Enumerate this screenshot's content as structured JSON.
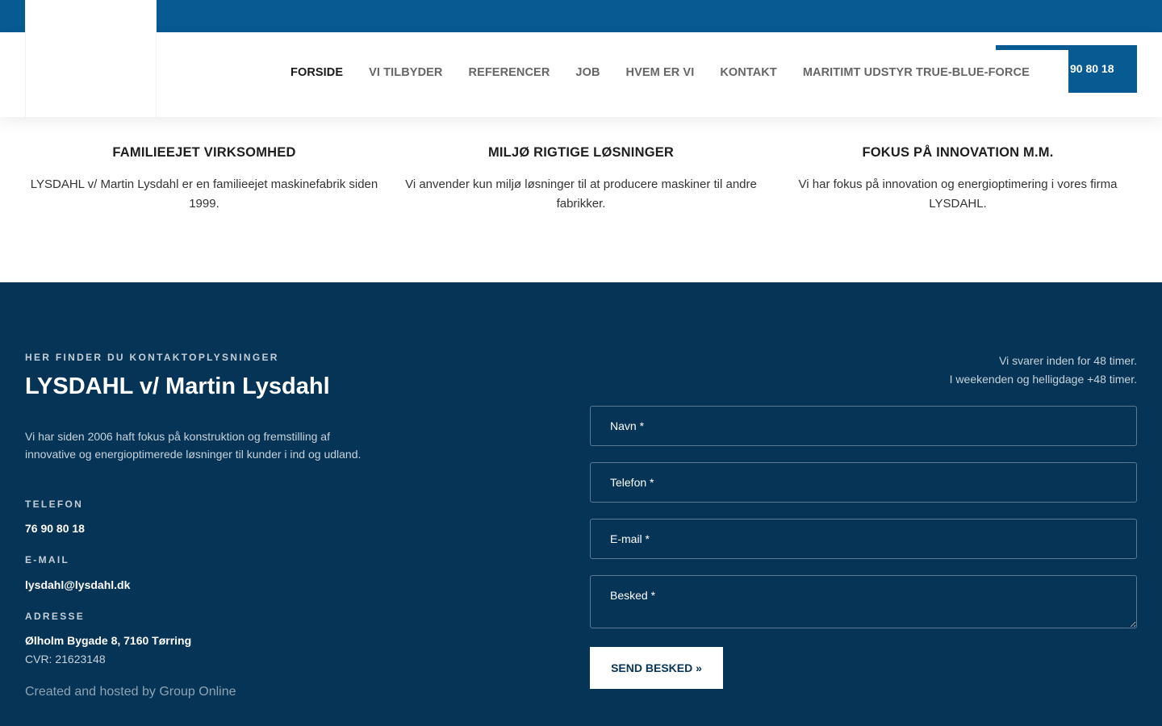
{
  "nav": {
    "items": [
      {
        "label": "FORSIDE"
      },
      {
        "label": "VI TILBYDER"
      },
      {
        "label": "REFERENCER"
      },
      {
        "label": "JOB"
      },
      {
        "label": "HVEM ER VI"
      },
      {
        "label": "KONTAKT"
      },
      {
        "label": "MARITIMT UDSTYR TRUE-BLUE-FORCE"
      }
    ],
    "phone": "90 80 18"
  },
  "features": [
    {
      "title": "FAMILIEEJET VIRKSOMHED",
      "text": "LYSDAHL v/ Martin Lysdahl er en familieejet maskinefabrik siden 1999."
    },
    {
      "title": "MILJØ RIGTIGE LØSNINGER",
      "text": "Vi anvender kun miljø løsninger til at producere maskiner til andre fabrikker."
    },
    {
      "title": "FOKUS PÅ INNOVATION M.M.",
      "text": "Vi har fokus på innovation og energioptimering i vores firma LYSDAHL."
    }
  ],
  "footer": {
    "kicker": "HER FINDER DU KONTAKTOPLYSNINGER",
    "title": "LYSDAHL v/ Martin Lysdahl",
    "description": "Vi har siden 2006 haft fokus på konstruktion og fremstilling af innovative og energioptimerede løsninger til kunder i ind og udland.",
    "phone_label": "TELEFON",
    "phone": "76 90 80 18",
    "email_label": "E-MAIL",
    "email": "lysdahl@lysdahl.dk",
    "address_label": "ADRESSE",
    "address": "Ølholm Bygade 8, 7160 Tørring",
    "cvr": "CVR: 21623148",
    "credit": "Created and hosted by Group Online",
    "notice_line1": "Vi svarer inden for 48 timer.",
    "notice_line2": "I weekenden og helligdage +48 timer."
  },
  "form": {
    "name_placeholder": "Navn *",
    "phone_placeholder": "Telefon *",
    "email_placeholder": "E-mail *",
    "message_placeholder": "Besked *",
    "submit_label": "SEND BESKED »"
  },
  "colors": {
    "brand_blue": "#075a92",
    "footer_navy": "#063456"
  }
}
